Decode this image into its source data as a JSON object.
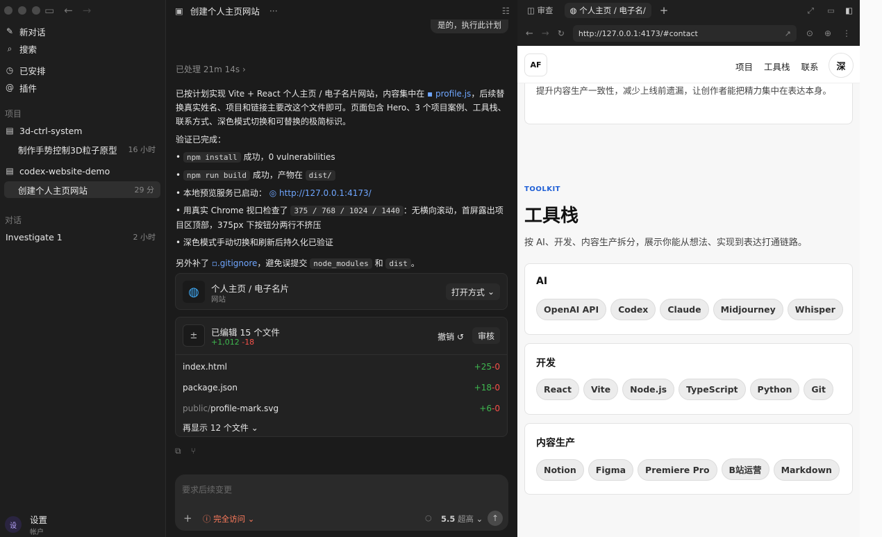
{
  "sidebar": {
    "new_chat": "新对话",
    "search": "搜索",
    "scheduled": "已安排",
    "plugins": "插件",
    "projects_head": "项目",
    "project1": "3d-ctrl-system",
    "project1_task": "制作手势控制3D粒子原型",
    "project1_time": "16 小时",
    "project2": "codex-website-demo",
    "project2_task": "创建个人主页网站",
    "project2_time": "29 分",
    "chats_head": "对话",
    "chat1": "Investigate 1",
    "chat1_time": "2 小时",
    "settings": "设置",
    "account": "帐户",
    "avatar": "设"
  },
  "thread": {
    "title": "创建个人主页网站",
    "more": "···",
    "user_bubble": "是的，执行此计划",
    "processed": "已处理 21m 14s",
    "p1a": "已按计划实现 Vite + React 个人主页 / 电子名片网站，内容集中在",
    "p1_file": "profile.js",
    "p1b": "，后续替换真实姓名、项目和链接主要改这个文件即可。页面包含 Hero、3 个项目案例、工具栈、联系方式、深色模式切换和可替换的极简标识。",
    "verified": "验证已完成：",
    "b1_code": "npm install",
    "b1_text": "成功，0 vulnerabilities",
    "b2_code": "npm run build",
    "b2_text": "成功，产物在",
    "b2_code2": "dist/",
    "b3_text": "本地预览服务已启动：",
    "b3_link": "http://127.0.0.1:4173/",
    "b4_text": "用真实 Chrome 视口检查了",
    "b4_code": "375 / 768 / 1024 / 1440",
    "b4_text2": "：无横向滚动，首屏露出项目区顶部，375px 下按钮分两行不挤压",
    "b5_text": "深色模式手动切换和刷新后持久化已验证",
    "p2a": "另外补了",
    "p2_file": ".gitignore",
    "p2b": "，避免误提交",
    "p2_code1": "node_modules",
    "p2_and": "和",
    "p2_code2": "dist",
    "p2_end": "。",
    "site_card_title": "个人主页 / 电子名片",
    "site_card_sub": "网站",
    "open_with": "打开方式",
    "edited_title": "已编辑 15 个文件",
    "edited_add": "+1,012",
    "edited_del": "-18",
    "undo": "撤销",
    "review": "审核",
    "files": [
      {
        "path": "index.html",
        "add": "+25",
        "del": "-0"
      },
      {
        "path": "package.json",
        "add": "+18",
        "del": "-0"
      },
      {
        "path_dim": "public/",
        "path": "profile-mark.svg",
        "add": "+6",
        "del": "-0"
      }
    ],
    "show_more": "再显示 12 个文件",
    "composer_placeholder": "要求后续变更",
    "access": "完全访问",
    "model": "5.5",
    "effort": "超高"
  },
  "browser": {
    "tab_review": "审查",
    "tab_active": "个人主页 / 电子名/",
    "url": "http://127.0.0.1:4173/#contact",
    "logo": "AF",
    "nav": [
      "项目",
      "工具栈",
      "联系"
    ],
    "theme_btn": "深",
    "prev_text": "提升内容生产一致性，减少上线前遗漏，让创作者能把精力集中在表达本身。",
    "eyebrow": "TOOLKIT",
    "heading": "工具栈",
    "desc": "按 AI、开发、内容生产拆分，展示你能从想法、实现到表达打通链路。",
    "groups": [
      {
        "title": "AI",
        "chips": [
          "OpenAI API",
          "Codex",
          "Claude",
          "Midjourney",
          "Whisper"
        ]
      },
      {
        "title": "开发",
        "chips": [
          "React",
          "Vite",
          "Node.js",
          "TypeScript",
          "Python",
          "Git"
        ]
      },
      {
        "title": "内容生产",
        "chips": [
          "Notion",
          "Figma",
          "Premiere Pro",
          "B站运营",
          "Markdown"
        ]
      }
    ]
  },
  "colors": {
    "accent": "#1f5fd6",
    "add": "#3fb950",
    "del": "#f85149",
    "access": "#ff7b5c"
  }
}
